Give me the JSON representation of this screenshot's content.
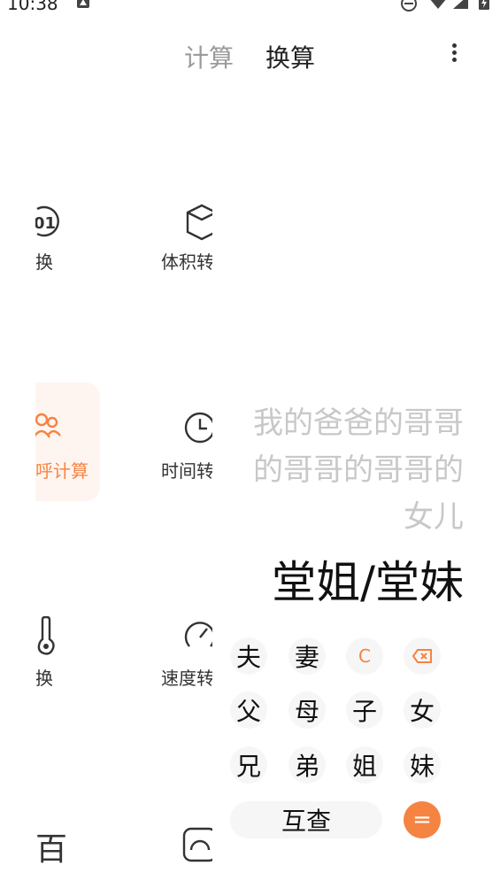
{
  "status": {
    "time": "10:38"
  },
  "tabs": {
    "calc": "计算",
    "convert": "换算"
  },
  "left_items": [
    {
      "label": "进制转换",
      "icon": "number-system-icon"
    },
    {
      "label": "体积转换",
      "icon": "volume-icon"
    },
    {
      "label": "亲戚称呼计算",
      "icon": "relatives-icon",
      "highlighted": true
    },
    {
      "label": "时间转换",
      "icon": "clock-icon"
    },
    {
      "label": "温度转换",
      "icon": "thermometer-icon"
    },
    {
      "label": "速度转换",
      "icon": "speedometer-icon"
    },
    {
      "label": "百",
      "icon": "hundred-icon"
    },
    {
      "label": "",
      "icon": "gauge-icon"
    }
  ],
  "calculator": {
    "expression": "我的爸爸的哥哥的哥哥的哥哥的女儿",
    "result": "堂姐/堂妹",
    "keys": {
      "husband": "夫",
      "wife": "妻",
      "clear": "C",
      "backspace": "⌫",
      "father": "父",
      "mother": "母",
      "son": "子",
      "daughter": "女",
      "elder_brother": "兄",
      "younger_brother": "弟",
      "elder_sister": "姐",
      "younger_sister": "妹",
      "mutual_check": "互查",
      "equals": "="
    }
  },
  "colors": {
    "accent": "#f58342",
    "key_bg": "#f6f6f6"
  }
}
